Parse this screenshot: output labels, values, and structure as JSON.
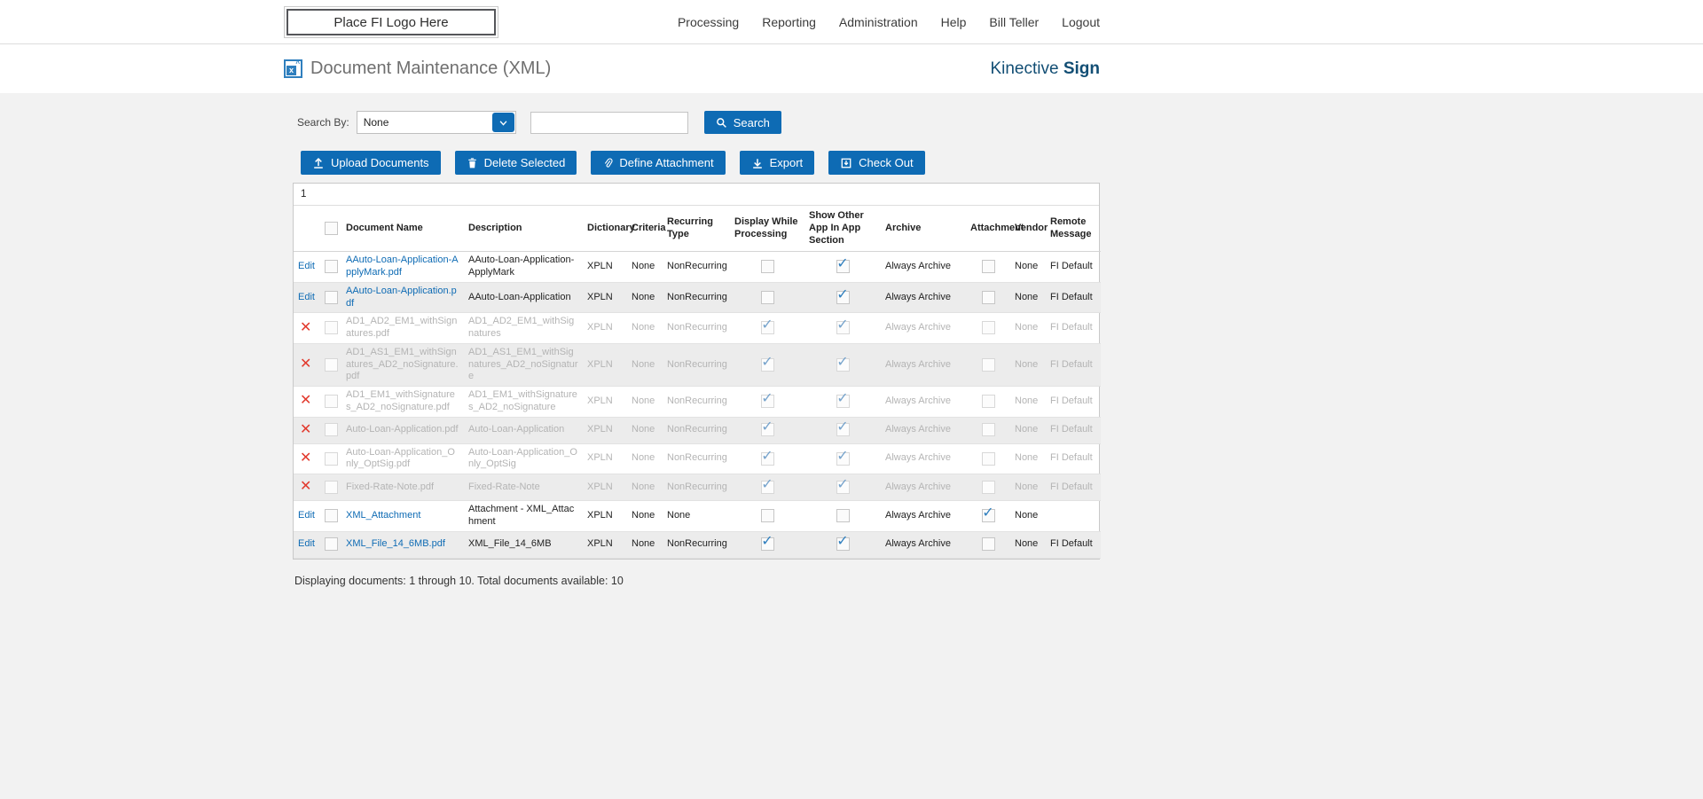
{
  "theme": {
    "primary": "#0e6bb4",
    "link": "#0e6bb4",
    "brand": "#124e74",
    "check": "#2f7fbe",
    "delete_x": "#e23a2e",
    "disabled_text": "#b4b4b4",
    "content_bg": "#f2f2f2"
  },
  "topbar": {
    "logo_text": "Place FI Logo Here",
    "nav": [
      "Processing",
      "Reporting",
      "Administration",
      "Help",
      "Bill Teller",
      "Logout"
    ]
  },
  "header": {
    "title": "Document Maintenance (XML)",
    "brand_name": "Kinective",
    "brand_bold": "Sign"
  },
  "search": {
    "label": "Search By:",
    "dropdown_value": "None",
    "input_value": "",
    "button_label": "Search"
  },
  "toolbar": {
    "buttons": [
      {
        "label": "Upload Documents",
        "icon": "upload-icon"
      },
      {
        "label": "Delete Selected",
        "icon": "trash-icon"
      },
      {
        "label": "Define Attachment",
        "icon": "paperclip-icon"
      },
      {
        "label": "Export",
        "icon": "download-icon"
      },
      {
        "label": "Check Out",
        "icon": "check-out-icon"
      }
    ]
  },
  "table": {
    "pagination": "1",
    "edit_label": "Edit",
    "columns": [
      "",
      "",
      "Document Name",
      "Description",
      "Dictionary",
      "Criteria",
      "Recurring Type",
      "Display While Processing",
      "Show Other App In App Section",
      "Archive",
      "Attachment",
      "Vendor",
      "Remote Message"
    ],
    "rows": [
      {
        "action": "edit",
        "disabled": false,
        "name": "AAuto-Loan-Application-ApplyMark.pdf",
        "description": "AAuto-Loan-Application-ApplyMark",
        "dictionary": "XPLN",
        "criteria": "None",
        "recurring_type": "NonRecurring",
        "display_while_processing": false,
        "show_other_app": true,
        "archive": "Always Archive",
        "attachment": false,
        "vendor": "None",
        "remote_message": "FI Default"
      },
      {
        "action": "edit",
        "disabled": false,
        "name": "AAuto-Loan-Application.pdf",
        "description": "AAuto-Loan-Application",
        "dictionary": "XPLN",
        "criteria": "None",
        "recurring_type": "NonRecurring",
        "display_while_processing": false,
        "show_other_app": true,
        "archive": "Always Archive",
        "attachment": false,
        "vendor": "None",
        "remote_message": "FI Default"
      },
      {
        "action": "delete",
        "disabled": true,
        "name": "AD1_AD2_EM1_withSignatures.pdf",
        "description": "AD1_AD2_EM1_withSignatures",
        "dictionary": "XPLN",
        "criteria": "None",
        "recurring_type": "NonRecurring",
        "display_while_processing": true,
        "show_other_app": true,
        "archive": "Always Archive",
        "attachment": false,
        "vendor": "None",
        "remote_message": "FI Default"
      },
      {
        "action": "delete",
        "disabled": true,
        "name": "AD1_AS1_EM1_withSignatures_AD2_noSignature.pdf",
        "description": "AD1_AS1_EM1_withSignatures_AD2_noSignature",
        "dictionary": "XPLN",
        "criteria": "None",
        "recurring_type": "NonRecurring",
        "display_while_processing": true,
        "show_other_app": true,
        "archive": "Always Archive",
        "attachment": false,
        "vendor": "None",
        "remote_message": "FI Default"
      },
      {
        "action": "delete",
        "disabled": true,
        "name": "AD1_EM1_withSignatures_AD2_noSignature.pdf",
        "description": "AD1_EM1_withSignatures_AD2_noSignature",
        "dictionary": "XPLN",
        "criteria": "None",
        "recurring_type": "NonRecurring",
        "display_while_processing": true,
        "show_other_app": true,
        "archive": "Always Archive",
        "attachment": false,
        "vendor": "None",
        "remote_message": "FI Default"
      },
      {
        "action": "delete",
        "disabled": true,
        "name": "Auto-Loan-Application.pdf",
        "description": "Auto-Loan-Application",
        "dictionary": "XPLN",
        "criteria": "None",
        "recurring_type": "NonRecurring",
        "display_while_processing": true,
        "show_other_app": true,
        "archive": "Always Archive",
        "attachment": false,
        "vendor": "None",
        "remote_message": "FI Default"
      },
      {
        "action": "delete",
        "disabled": true,
        "name": "Auto-Loan-Application_Only_OptSig.pdf",
        "description": "Auto-Loan-Application_Only_OptSig",
        "dictionary": "XPLN",
        "criteria": "None",
        "recurring_type": "NonRecurring",
        "display_while_processing": true,
        "show_other_app": true,
        "archive": "Always Archive",
        "attachment": false,
        "vendor": "None",
        "remote_message": "FI Default"
      },
      {
        "action": "delete",
        "disabled": true,
        "name": "Fixed-Rate-Note.pdf",
        "description": "Fixed-Rate-Note",
        "dictionary": "XPLN",
        "criteria": "None",
        "recurring_type": "NonRecurring",
        "display_while_processing": true,
        "show_other_app": true,
        "archive": "Always Archive",
        "attachment": false,
        "vendor": "None",
        "remote_message": "FI Default"
      },
      {
        "action": "edit",
        "disabled": false,
        "name": "XML_Attachment",
        "description": "Attachment - XML_Attachment",
        "dictionary": "XPLN",
        "criteria": "None",
        "recurring_type": "None",
        "display_while_processing": false,
        "show_other_app": false,
        "archive": "Always Archive",
        "attachment": true,
        "vendor": "None",
        "remote_message": ""
      },
      {
        "action": "edit",
        "disabled": false,
        "name": "XML_File_14_6MB.pdf",
        "description": "XML_File_14_6MB",
        "dictionary": "XPLN",
        "criteria": "None",
        "recurring_type": "NonRecurring",
        "display_while_processing": true,
        "show_other_app": true,
        "archive": "Always Archive",
        "attachment": false,
        "vendor": "None",
        "remote_message": "FI Default"
      }
    ]
  },
  "footer": {
    "summary": "Displaying documents: 1 through 10. Total documents available: 10"
  }
}
